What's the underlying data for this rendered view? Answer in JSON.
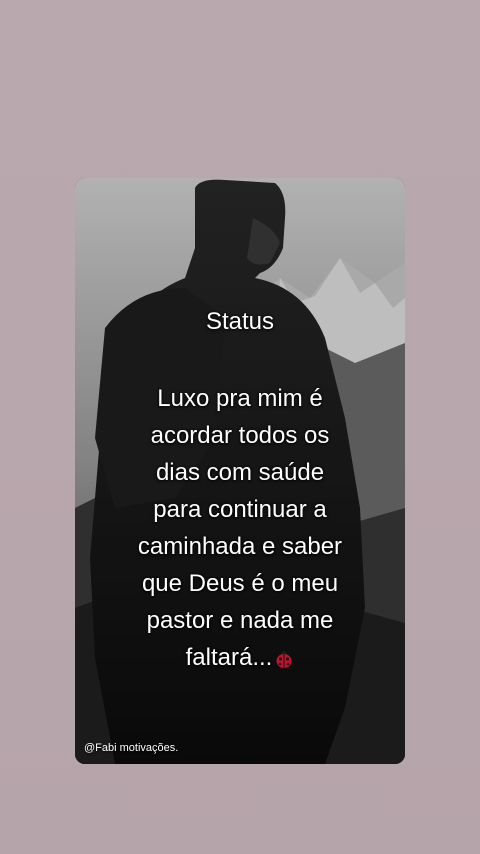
{
  "post": {
    "title": "Status",
    "quote_lines": [
      "Luxo pra mim é",
      "acordar todos os",
      "dias com saúde",
      "para continuar a",
      "caminhada e saber",
      "que Deus é o meu",
      "pastor e nada me",
      "faltará..."
    ],
    "emoji_icon": "ladybug-icon",
    "watermark": "@Fabi motivações."
  },
  "colors": {
    "page_background": "#b8a7ad",
    "text": "#ffffff",
    "ladybug_red": "#c8102e"
  }
}
